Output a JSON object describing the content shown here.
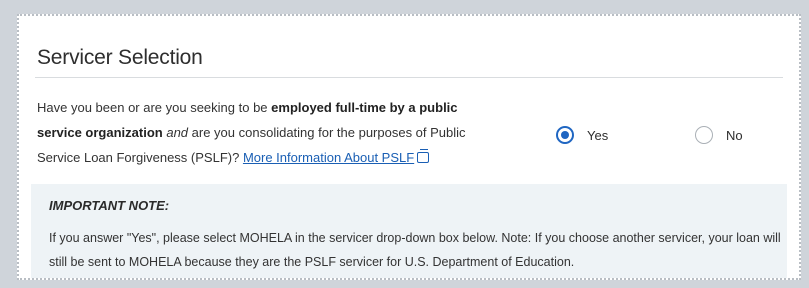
{
  "section": {
    "title": "Servicer Selection"
  },
  "question": {
    "part1": "Have you been or are you seeking to be ",
    "bold": "employed full-time by a public service organization",
    "italic": "and",
    "part2": " are you consolidating for the purposes of Public Service Loan Forgiveness (PSLF)? ",
    "link": "More Information About PSLF",
    "link_icon": "external-link-icon"
  },
  "radios": {
    "yes_label": "Yes",
    "no_label": "No",
    "selected": "Yes"
  },
  "note": {
    "title": "IMPORTANT NOTE:",
    "text": "If you answer \"Yes\", please select MOHELA in the servicer drop-down box below. Note: If you choose another servicer, your loan will still be sent to MOHELA because they are the PSLF servicer for U.S. Department of Education."
  },
  "colors": {
    "accent": "#1f66c2",
    "link": "#1a5fb4",
    "note_bg": "#eef3f6",
    "page_bg": "#cfd4da"
  }
}
